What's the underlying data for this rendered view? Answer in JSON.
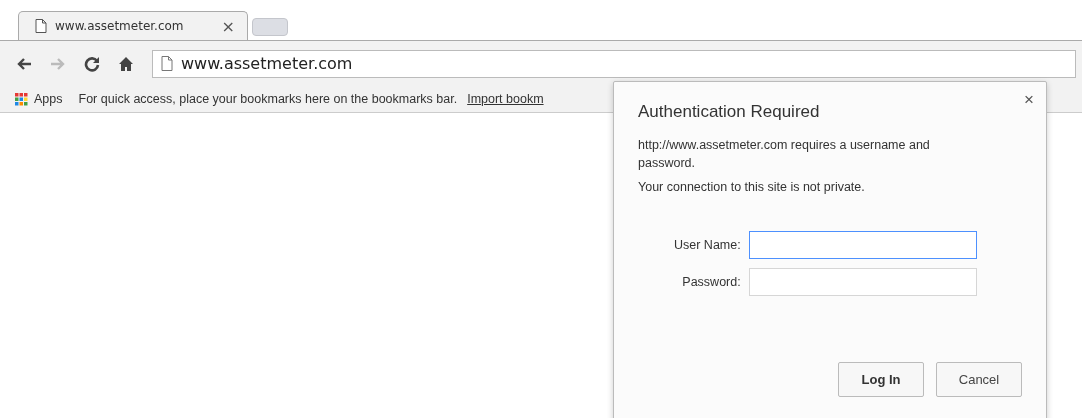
{
  "tabs": [
    {
      "title": "www.assetmeter.com",
      "close": "×"
    }
  ],
  "toolbar": {
    "back_enabled": true,
    "forward_enabled": false,
    "address": "www.assetmeter.com"
  },
  "bookmarks_bar": {
    "apps": "Apps",
    "message": "For quick access, place your bookmarks here on the bookmarks bar.",
    "link": "Import bookm"
  },
  "dialog": {
    "title": "Authentication Required",
    "close": "×",
    "message": "http://www.assetmeter.com requires a username and password.",
    "note": "Your connection to this site is not private.",
    "fields": [
      {
        "label": "User Name:",
        "focused": true
      },
      {
        "label": "Password:",
        "focused": false
      }
    ],
    "buttons": [
      {
        "label": "Log In",
        "kind": "primary"
      },
      {
        "label": "Cancel",
        "kind": "secondary"
      }
    ]
  }
}
